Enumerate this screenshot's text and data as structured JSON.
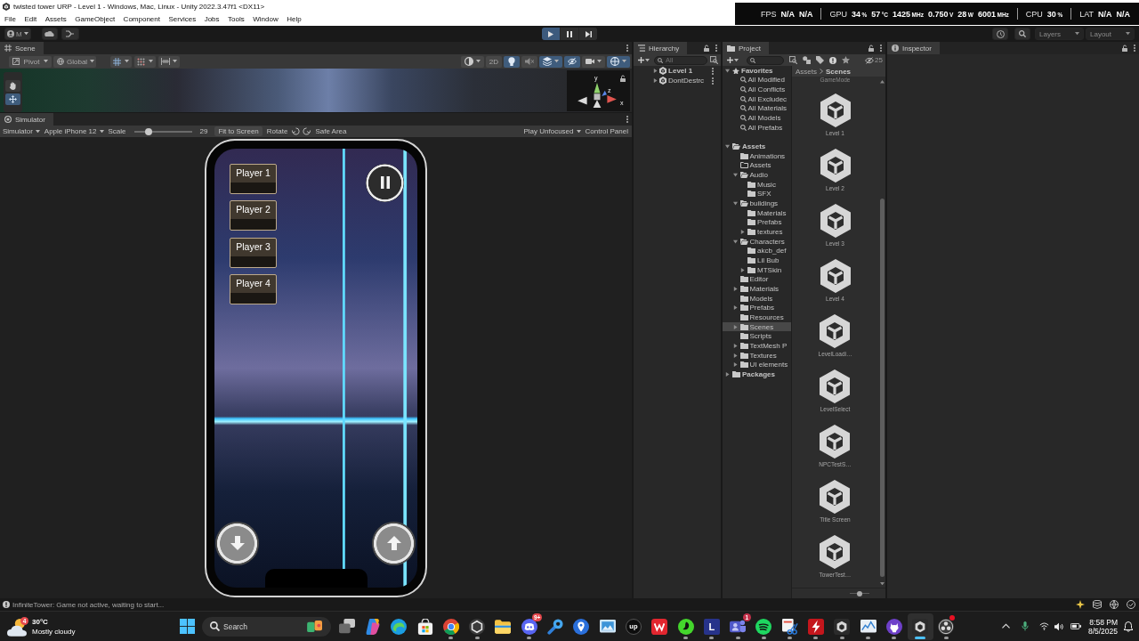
{
  "window": {
    "title": "twisted tower URP - Level 1 - Windows, Mac, Linux - Unity 2022.3.47f1 <DX11>"
  },
  "performance_overlay": [
    {
      "label": "FPS",
      "readings": [
        {
          "value": "N/A"
        },
        {
          "value": "N/A"
        }
      ]
    },
    {
      "label": "GPU",
      "readings": [
        {
          "value": "34",
          "unit": "%"
        },
        {
          "value": "57",
          "unit": "°C"
        },
        {
          "value": "1425",
          "unit": "MHz"
        },
        {
          "value": "0.750",
          "unit": "V"
        },
        {
          "value": "28",
          "unit": "W"
        },
        {
          "value": "6001",
          "unit": "MHz"
        }
      ]
    },
    {
      "label": "CPU",
      "readings": [
        {
          "value": "30",
          "unit": "%"
        }
      ]
    },
    {
      "label": "LAT",
      "readings": [
        {
          "value": "N/A"
        },
        {
          "value": "N/A"
        }
      ]
    }
  ],
  "menu": [
    "File",
    "Edit",
    "Assets",
    "GameObject",
    "Component",
    "Services",
    "Jobs",
    "Tools",
    "Window",
    "Help"
  ],
  "toolbar": {
    "account": "M",
    "play_controls": [
      {
        "kind": "play",
        "on": true
      },
      {
        "kind": "pause",
        "on": false
      },
      {
        "kind": "step",
        "on": false
      }
    ],
    "layers": "Layers",
    "layout": "Layout"
  },
  "scene": {
    "tab": "Scene",
    "pivot": "Pivot",
    "handle_space": "Global",
    "view_options": [
      {
        "kind": "shading",
        "on": false
      },
      {
        "kind": "flat",
        "label": "2D",
        "on": false
      },
      {
        "kind": "lighting",
        "on": true
      },
      {
        "kind": "audio",
        "on": false
      },
      {
        "kind": "effects",
        "on": true
      },
      {
        "kind": "visibility",
        "on": true
      },
      {
        "kind": "camera",
        "on": false
      },
      {
        "kind": "gizmos",
        "on": true
      }
    ],
    "tools": [
      {
        "kind": "hand",
        "selected": false
      },
      {
        "kind": "move",
        "selected": true
      }
    ],
    "axes": [
      "y",
      "z",
      "x"
    ]
  },
  "simulator": {
    "tab": "Simulator",
    "mode": "Simulator",
    "device": "Apple iPhone 12",
    "scale_label": "Scale",
    "scale": {
      "level": 0.26
    },
    "scale_value": "29",
    "fit_button": "Fit to Screen",
    "rotate_label": "Rotate",
    "safe_area": "Safe Area",
    "play_focus": "Play Unfocused",
    "control_panel": "Control Panel",
    "game": {
      "players": [
        "Player 1",
        "Player 2",
        "Player 3",
        "Player 4"
      ]
    }
  },
  "hierarchy": {
    "tab": "Hierarchy",
    "search": {
      "placeholder": "All"
    },
    "items": [
      {
        "label": "Level 1",
        "active": true,
        "expanded": false,
        "selected": false
      },
      {
        "label": "DontDestrc",
        "active": false,
        "expanded": false,
        "selected": false
      }
    ]
  },
  "project": {
    "tab": "Project",
    "hidden_count": "25",
    "tree": [
      {
        "label": "Favorites",
        "kind": "favorites",
        "expanded": true,
        "selected": false,
        "children": [
          {
            "label": "All Modified",
            "kind": "search",
            "selected": false
          },
          {
            "label": "All Conflicts",
            "kind": "search",
            "selected": false
          },
          {
            "label": "All Excludec",
            "kind": "search",
            "selected": false
          },
          {
            "label": "All Materials",
            "kind": "search",
            "selected": false
          },
          {
            "label": "All Models",
            "kind": "search",
            "selected": false
          },
          {
            "label": "All Prefabs",
            "kind": "search",
            "selected": false
          }
        ]
      },
      {
        "label": "Assets",
        "kind": "folder",
        "expanded": true,
        "selected": false,
        "children": [
          {
            "label": "Animations",
            "kind": "folder",
            "selected": false
          },
          {
            "label": "Assets",
            "kind": "empty-folder",
            "selected": false
          },
          {
            "label": "Audio",
            "kind": "folder",
            "expanded": true,
            "selected": false,
            "children": [
              {
                "label": "Music",
                "kind": "folder",
                "selected": false
              },
              {
                "label": "SFX",
                "kind": "folder",
                "selected": false
              }
            ]
          },
          {
            "label": "buildings",
            "kind": "folder",
            "expanded": true,
            "selected": false,
            "children": [
              {
                "label": "Materials",
                "kind": "folder",
                "selected": false
              },
              {
                "label": "Prefabs",
                "kind": "folder",
                "selected": false
              },
              {
                "label": "textures",
                "kind": "folder",
                "expanded": false,
                "selected": false
              }
            ]
          },
          {
            "label": "Characters",
            "kind": "folder",
            "expanded": true,
            "selected": false,
            "children": [
              {
                "label": "akcb_def",
                "kind": "folder",
                "selected": false
              },
              {
                "label": "Lil Bub",
                "kind": "folder",
                "selected": false
              },
              {
                "label": "MTSkin",
                "kind": "folder",
                "expanded": false,
                "selected": false
              }
            ]
          },
          {
            "label": "Editor",
            "kind": "folder",
            "selected": false
          },
          {
            "label": "Materials",
            "kind": "folder",
            "expanded": false,
            "selected": false
          },
          {
            "label": "Models",
            "kind": "folder",
            "selected": false
          },
          {
            "label": "Prefabs",
            "kind": "folder",
            "expanded": false,
            "selected": false
          },
          {
            "label": "Resources",
            "kind": "folder",
            "selected": false
          },
          {
            "label": "Scenes",
            "kind": "folder",
            "expanded": false,
            "selected": true
          },
          {
            "label": "Scripts",
            "kind": "folder",
            "selected": false
          },
          {
            "label": "TextMesh P",
            "kind": "folder",
            "expanded": false,
            "selected": false
          },
          {
            "label": "Textures",
            "kind": "folder",
            "expanded": false,
            "selected": false
          },
          {
            "label": "UI elements",
            "kind": "folder",
            "expanded": false,
            "selected": false
          }
        ]
      },
      {
        "label": "Packages",
        "kind": "folder",
        "expanded": false,
        "selected": false
      }
    ],
    "breadcrumb": [
      "Assets",
      "Scenes"
    ],
    "assets": [
      {
        "label": "GameMode",
        "kind": "clipped",
        "selected": false
      },
      {
        "label": "Level 1",
        "kind": "scene",
        "selected": false
      },
      {
        "label": "Level 2",
        "kind": "scene",
        "selected": false
      },
      {
        "label": "Level 3",
        "kind": "scene",
        "selected": false
      },
      {
        "label": "Level 4",
        "kind": "scene",
        "selected": false
      },
      {
        "label": "LevelLoadi…",
        "kind": "scene",
        "selected": false
      },
      {
        "label": "LevelSelect",
        "kind": "scene",
        "selected": false
      },
      {
        "label": "NPCTestS…",
        "kind": "scene",
        "selected": false
      },
      {
        "label": "Title Screen",
        "kind": "scene",
        "selected": false
      },
      {
        "label": "TowerTest…",
        "kind": "scene",
        "selected": false
      }
    ],
    "icon_size": {
      "level": 0.5
    }
  },
  "inspector": {
    "tab": "Inspector"
  },
  "status_bar": {
    "message": "InfiniteTower: Game not active, waiting to start..."
  },
  "taskbar": {
    "weather": {
      "temperature": "30°C",
      "condition": "Mostly cloudy",
      "badge": "4"
    },
    "search": {
      "placeholder": "Search"
    },
    "apps": [
      {
        "kind": "stack",
        "running": false,
        "selected": false
      },
      {
        "kind": "blob",
        "running": false,
        "selected": false
      },
      {
        "kind": "swirl",
        "running": false,
        "selected": false
      },
      {
        "kind": "bag",
        "running": false,
        "selected": false
      },
      {
        "kind": "tricolor",
        "running": true,
        "selected": false
      },
      {
        "kind": "hex",
        "running": true,
        "selected": false
      },
      {
        "kind": "folder",
        "running": false,
        "selected": false
      },
      {
        "kind": "chat",
        "running": true,
        "selected": false,
        "badge": {
          "text": "9+",
          "color": "#e5484d"
        }
      },
      {
        "kind": "key",
        "running": false,
        "selected": false
      },
      {
        "kind": "pin",
        "running": false,
        "selected": false
      },
      {
        "kind": "photo",
        "running": false,
        "selected": false
      },
      {
        "kind": "text-disc",
        "glyph": "up",
        "running": false,
        "selected": false
      },
      {
        "kind": "zigzag",
        "running": false,
        "selected": false
      },
      {
        "kind": "snake",
        "running": true,
        "selected": false
      },
      {
        "kind": "text-tile",
        "glyph": "L",
        "running": true,
        "selected": false
      },
      {
        "kind": "people",
        "running": true,
        "selected": false,
        "badge": {
          "text": "1",
          "color": "#c4314b"
        }
      },
      {
        "kind": "waves",
        "running": true,
        "selected": false
      },
      {
        "kind": "scissors",
        "running": true,
        "selected": false
      },
      {
        "kind": "bolt",
        "running": true,
        "selected": false
      },
      {
        "kind": "cube",
        "running": true,
        "selected": false
      },
      {
        "kind": "chart",
        "running": true,
        "selected": false
      },
      {
        "kind": "cat",
        "running": true,
        "selected": false
      },
      {
        "kind": "cube",
        "running": true,
        "selected": true
      },
      {
        "kind": "rings",
        "running": true,
        "selected": false,
        "badge": {
          "color": "#e81123"
        }
      }
    ],
    "clock": {
      "time": "8:58 PM",
      "date": "8/5/2025"
    }
  }
}
